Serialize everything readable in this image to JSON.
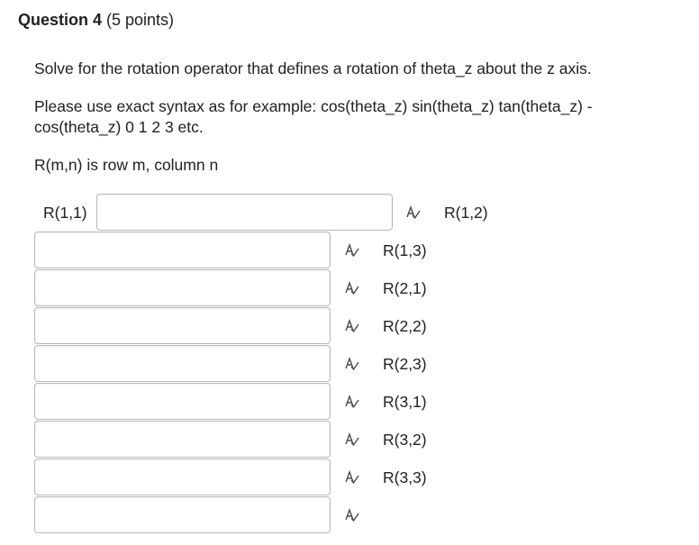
{
  "question": {
    "title": "Question 4",
    "points": " (5 points)"
  },
  "prompt": {
    "line1": "Solve for the rotation operator that defines a rotation of theta_z about the z axis.",
    "line2a": "Please use exact syntax as for example: cos(theta_z) sin(theta_z) tan(theta_z) -",
    "line2b": "cos(theta_z) 0 1 2 3 etc.",
    "line3": "R(m,n) is row m, column n"
  },
  "fields": {
    "labels": [
      "R(1,1)",
      "R(1,2)",
      "R(1,3)",
      "R(2,1)",
      "R(2,2)",
      "R(2,3)",
      "R(3,1)",
      "R(3,2)",
      "R(3,3)"
    ],
    "values": [
      "",
      "",
      "",
      "",
      "",
      "",
      "",
      "",
      ""
    ]
  },
  "icons": {
    "spellcheck": "spellcheck-icon"
  }
}
